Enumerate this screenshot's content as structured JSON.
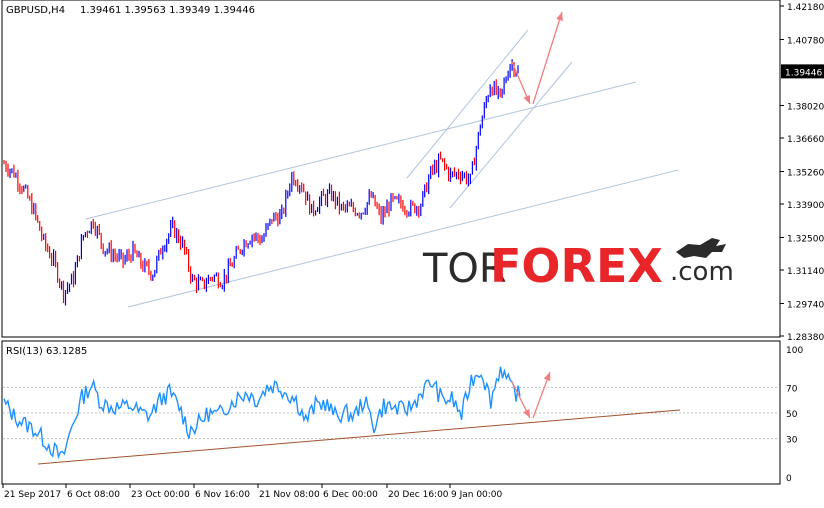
{
  "header": {
    "symbol": "GBPUSD,H4",
    "quote": "1.39461 1.39563 1.39349 1.39446"
  },
  "chart_data": [
    {
      "type": "line",
      "title": "GBPUSD,H4",
      "ylim": [
        1.2838,
        1.4218
      ],
      "price_axis_labels": [
        "1.42180",
        "1.40780",
        "1.39446",
        "1.38020",
        "1.36660",
        "1.35260",
        "1.33900",
        "1.32500",
        "1.31140",
        "1.29740",
        "1.28380"
      ],
      "price_axis_values": [
        1.4218,
        1.4078,
        1.39446,
        1.3802,
        1.3666,
        1.3526,
        1.339,
        1.325,
        1.3114,
        1.2974,
        1.2838
      ],
      "current_price": "1.39446",
      "x_labels": [
        "21 Sep 2017",
        "6 Oct 08:00",
        "23 Oct 00:00",
        "6 Nov 16:00",
        "21 Nov 08:00",
        "6 Dec 00:00",
        "20 Dec 16:00",
        "9 Jan 00:00"
      ],
      "series": [
        {
          "values": [
            1.356,
            1.352,
            1.345,
            1.336,
            1.323,
            1.315,
            1.302,
            1.308,
            1.326,
            1.332,
            1.321,
            1.318,
            1.315,
            1.319,
            1.313,
            1.31,
            1.322,
            1.329,
            1.322,
            1.307,
            1.305,
            1.309,
            1.307,
            1.314,
            1.322,
            1.326,
            1.324,
            1.333,
            1.334,
            1.351,
            1.347,
            1.336,
            1.341,
            1.343,
            1.337,
            1.337,
            1.336,
            1.342,
            1.333,
            1.34,
            1.339,
            1.337,
            1.339,
            1.352,
            1.357,
            1.351,
            1.352,
            1.349,
            1.372,
            1.389,
            1.383,
            1.398,
            1.394
          ]
        }
      ],
      "annotations": [
        "upper channel line",
        "lower channel line",
        "steep rising channel",
        "red arrow down then up"
      ]
    },
    {
      "type": "line",
      "title": "RSI(13) 63.1285",
      "ylim": [
        0,
        100
      ],
      "y_axis_labels": [
        "100",
        "70",
        "50",
        "30",
        "0"
      ],
      "y_axis_values": [
        100,
        70,
        50,
        30,
        0
      ],
      "series": [
        {
          "name": "RSI(13)",
          "values": [
            58,
            48,
            42,
            38,
            30,
            22,
            14,
            40,
            62,
            72,
            58,
            55,
            54,
            56,
            50,
            48,
            60,
            66,
            55,
            36,
            42,
            50,
            48,
            56,
            62,
            66,
            60,
            70,
            72,
            66,
            60,
            44,
            56,
            58,
            48,
            50,
            48,
            60,
            40,
            56,
            54,
            52,
            56,
            68,
            74,
            60,
            61,
            48,
            76,
            84,
            60,
            86,
            70,
            63
          ]
        }
      ],
      "annotations": [
        "rising trend line",
        "red arrow down then up"
      ]
    }
  ],
  "watermark": {
    "part1": "TOR",
    "part2": "FOREX",
    "part3": ".com"
  },
  "colors": {
    "bull_bar": "#0000ff",
    "bear_bar": "#ff0000",
    "channel": "#b0c4de",
    "arrow": "#f08080",
    "rsi": "#1e90ff",
    "rsi_trend": "#a0522d",
    "watermark_dark": "#2b2b2b",
    "watermark_red": "#e8262a"
  }
}
